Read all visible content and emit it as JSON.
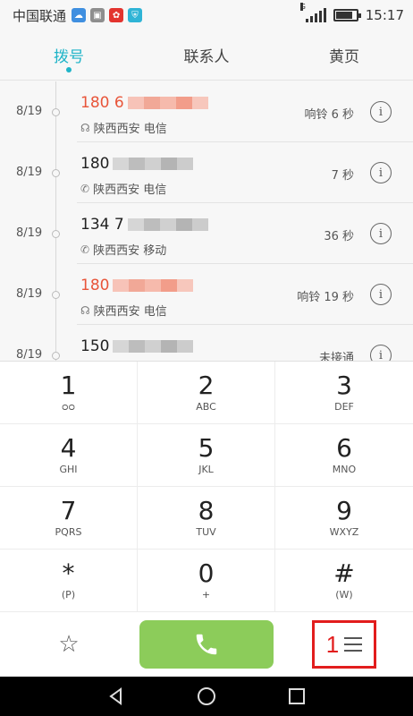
{
  "status_bar": {
    "carrier": "中国联通",
    "signal_label": "G",
    "time": "15:17",
    "battery_level": 0.85
  },
  "tabs": [
    {
      "label": "拨号",
      "active": true
    },
    {
      "label": "联系人",
      "active": false
    },
    {
      "label": "黄页",
      "active": false
    }
  ],
  "call_log": [
    {
      "date": "8/19",
      "number": "180 6",
      "missed": true,
      "location": "陕西西安 电信",
      "call_icon": "missed-call-icon",
      "duration": "响铃 6 秒"
    },
    {
      "date": "8/19",
      "number": "180",
      "missed": false,
      "location": "陕西西安 电信",
      "call_icon": "outgoing-call-icon",
      "duration": "7 秒"
    },
    {
      "date": "8/19",
      "number": "134 7",
      "missed": false,
      "location": "陕西西安 移动",
      "call_icon": "outgoing-call-icon",
      "duration": "36 秒"
    },
    {
      "date": "8/19",
      "number": "180",
      "missed": true,
      "location": "陕西西安 电信",
      "call_icon": "missed-call-icon",
      "duration": "响铃 19 秒"
    },
    {
      "date": "8/19",
      "number": "150",
      "missed": false,
      "location": "",
      "call_icon": "outgoing-call-icon",
      "duration": "未接通"
    }
  ],
  "keypad": [
    {
      "digit": "1",
      "letters": "ᴑᴑ"
    },
    {
      "digit": "2",
      "letters": "ABC"
    },
    {
      "digit": "3",
      "letters": "DEF"
    },
    {
      "digit": "4",
      "letters": "GHI"
    },
    {
      "digit": "5",
      "letters": "JKL"
    },
    {
      "digit": "6",
      "letters": "MNO"
    },
    {
      "digit": "7",
      "letters": "PQRS"
    },
    {
      "digit": "8",
      "letters": "TUV"
    },
    {
      "digit": "9",
      "letters": "WXYZ"
    },
    {
      "digit": "*",
      "letters": "(P)"
    },
    {
      "digit": "0",
      "letters": "+"
    },
    {
      "digit": "#",
      "letters": "(W)"
    }
  ],
  "actions": {
    "favorite_icon": "star-icon",
    "call_icon": "phone-icon",
    "menu_annotation": "1",
    "menu_icon": "hamburger-icon"
  },
  "colors": {
    "accent": "#1fb4c8",
    "missed": "#e8553a",
    "call_button": "#8ccc5a",
    "annotation": "#e21d1d"
  }
}
